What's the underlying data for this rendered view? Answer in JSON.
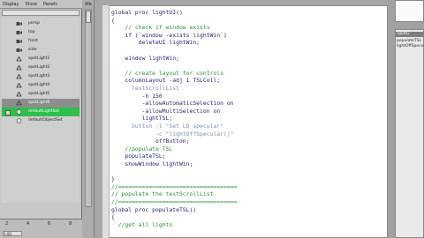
{
  "outliner": {
    "menu": [
      "Display",
      "Show",
      "Panels"
    ],
    "nodes": [
      {
        "label": "persp",
        "style": "normal"
      },
      {
        "label": "top",
        "style": "normal"
      },
      {
        "label": "front",
        "style": "normal"
      },
      {
        "label": "side",
        "style": "normal"
      },
      {
        "label": "spotLight1",
        "style": "normal"
      },
      {
        "label": "spotLight2",
        "style": "normal"
      },
      {
        "label": "spotLight3",
        "style": "normal"
      },
      {
        "label": "spotLight4",
        "style": "normal"
      },
      {
        "label": "spotLight5",
        "style": "normal"
      },
      {
        "label": "spotLight6",
        "style": "selected"
      },
      {
        "label": "defaultLightSet",
        "style": "green"
      },
      {
        "label": "defaultObjectSet",
        "style": "normal"
      }
    ]
  },
  "timeline": {
    "ticks": [
      "2",
      "4",
      "6",
      "8"
    ],
    "current": "1.00"
  },
  "vertical_strip": {
    "label": "Vie"
  },
  "editor": {
    "lines": [
      {
        "text": "global proc lightUI()",
        "cls": "code"
      },
      {
        "text": "{",
        "cls": "code"
      },
      {
        "text": "    // check if window exists",
        "cls": "cmt"
      },
      {
        "text": "    if (`window -exists lightWin`)",
        "cls": "code"
      },
      {
        "text": "        deleteUI lightWin;",
        "cls": "code"
      },
      {
        "text": "",
        "cls": "code"
      },
      {
        "text": "    window lightWin;",
        "cls": "code"
      },
      {
        "text": "",
        "cls": "code"
      },
      {
        "text": "    // create layout for controls",
        "cls": "cmt"
      },
      {
        "text": "    columnLayout -adj 1 TSLColl;",
        "cls": "code"
      },
      {
        "text": "      textScrollList",
        "cls": "str"
      },
      {
        "text": "         -h 150",
        "cls": "code"
      },
      {
        "text": "         -allowAutomaticSelection on",
        "cls": "code"
      },
      {
        "text": "         -allowMultiSelection on",
        "cls": "code"
      },
      {
        "text": "         lightTSL;",
        "cls": "code"
      },
      {
        "text": "      button -l \"Set LD specular\"",
        "cls": "str"
      },
      {
        "text": "             -c \"lightOffSpecular()\"",
        "cls": "str"
      },
      {
        "text": "             offButton;",
        "cls": "code"
      },
      {
        "text": "    //populate TSL",
        "cls": "cmt"
      },
      {
        "text": "    populateTSL;",
        "cls": "code"
      },
      {
        "text": "    showWindow lightWin;",
        "cls": "code"
      },
      {
        "text": "",
        "cls": "code"
      },
      {
        "text": "}",
        "cls": "code"
      },
      {
        "text": "//===================================",
        "cls": "cmt"
      },
      {
        "text": "// populate the textScrollList",
        "cls": "cmt"
      },
      {
        "text": "//===================================",
        "cls": "cmt"
      },
      {
        "text": "global proc populateTSL()",
        "cls": "code"
      },
      {
        "text": "{",
        "cls": "code"
      },
      {
        "text": "  //get all lights",
        "cls": "cmt"
      }
    ]
  },
  "right_panel": {
    "selected": "spotLi",
    "items": [
      "populateTSL",
      "lightOffSpecu"
    ]
  }
}
